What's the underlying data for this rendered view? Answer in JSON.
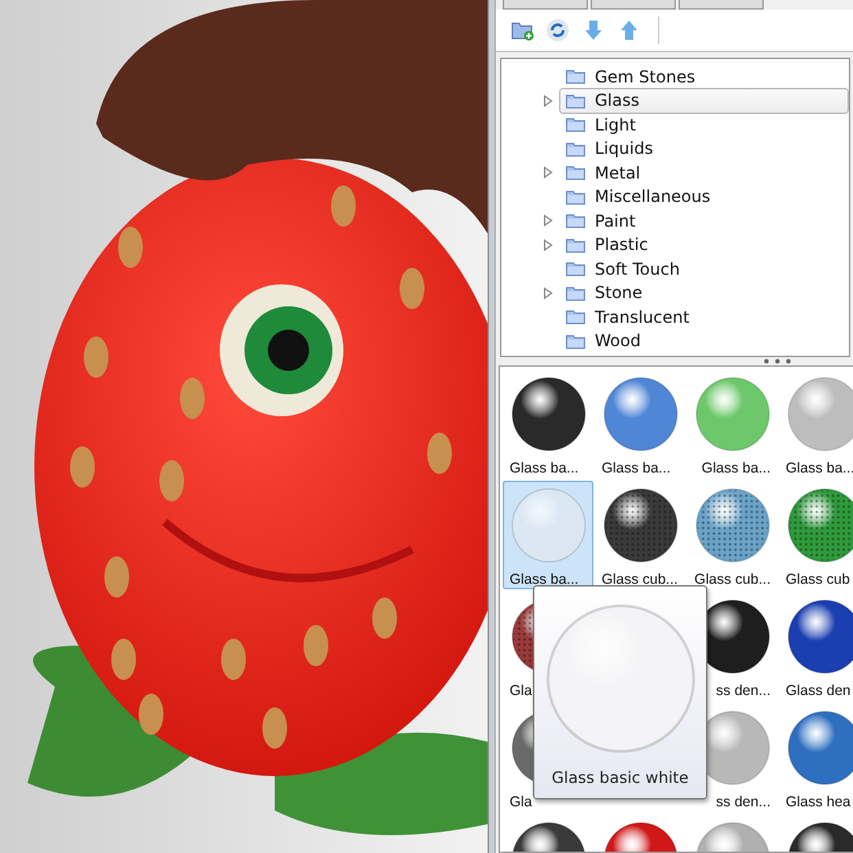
{
  "panel_tabs": [
    {
      "selected": false
    },
    {
      "selected": false
    },
    {
      "selected": false
    }
  ],
  "tree": [
    {
      "label": "Gem Stones",
      "expandable": false,
      "selected": false
    },
    {
      "label": "Glass",
      "expandable": true,
      "selected": true
    },
    {
      "label": "Light",
      "expandable": false,
      "selected": false
    },
    {
      "label": "Liquids",
      "expandable": false,
      "selected": false
    },
    {
      "label": "Metal",
      "expandable": true,
      "selected": false
    },
    {
      "label": "Miscellaneous",
      "expandable": false,
      "selected": false
    },
    {
      "label": "Paint",
      "expandable": true,
      "selected": false
    },
    {
      "label": "Plastic",
      "expandable": true,
      "selected": false
    },
    {
      "label": "Soft Touch",
      "expandable": false,
      "selected": false
    },
    {
      "label": "Stone",
      "expandable": true,
      "selected": false
    },
    {
      "label": "Translucent",
      "expandable": false,
      "selected": false
    },
    {
      "label": "Wood",
      "expandable": false,
      "selected": false
    }
  ],
  "materials": [
    {
      "label": "Glass ba...",
      "kind": "glossy",
      "color": "#2a2a2a",
      "selected": false
    },
    {
      "label": "Glass ba...",
      "kind": "glossy",
      "color": "#4f86d6",
      "selected": false
    },
    {
      "label": "Glass ba...",
      "kind": "glossy",
      "color": "#6cc86a",
      "selected": false
    },
    {
      "label": "Glass ba...",
      "kind": "glossy",
      "color": "#bdbdbd",
      "selected": false
    },
    {
      "label": "Glass ba...",
      "kind": "glossy",
      "color": "#dbe8f3",
      "selected": true
    },
    {
      "label": "Glass cub...",
      "kind": "speckled",
      "color": "#3a3a3a",
      "selected": false
    },
    {
      "label": "Glass cub...",
      "kind": "speckled",
      "color": "#6aa3c8",
      "selected": false
    },
    {
      "label": "Glass cub",
      "kind": "speckled",
      "color": "#2f9a3c",
      "selected": false
    },
    {
      "label": "Gla",
      "kind": "speckled",
      "color": "#9a3a3a",
      "selected": false
    },
    {
      "kind": "covered"
    },
    {
      "label": "ss den...",
      "kind": "glossy",
      "color": "#1e1e1e",
      "selected": false
    },
    {
      "label": "Glass den",
      "kind": "glossy",
      "color": "#1b3fb0",
      "selected": false
    },
    {
      "label": "Gla",
      "kind": "glossy",
      "color": "#6a6a6a",
      "selected": false
    },
    {
      "kind": "covered"
    },
    {
      "label": "ss den...",
      "kind": "glossy",
      "color": "#b8b8b8",
      "selected": false
    },
    {
      "label": "Glass hea",
      "kind": "glossy",
      "color": "#2f6fc0",
      "selected": false
    },
    {
      "kind": "matte",
      "color": "#3a3a3a",
      "selected": false
    },
    {
      "kind": "matte",
      "color": "#d01818",
      "selected": false
    },
    {
      "kind": "matte",
      "color": "#b0b0b0",
      "selected": false
    },
    {
      "kind": "matte",
      "color": "#2a2a2a",
      "selected": false
    }
  ],
  "tooltip": {
    "label": "Glass basic white",
    "color": "#f4f4f6"
  }
}
